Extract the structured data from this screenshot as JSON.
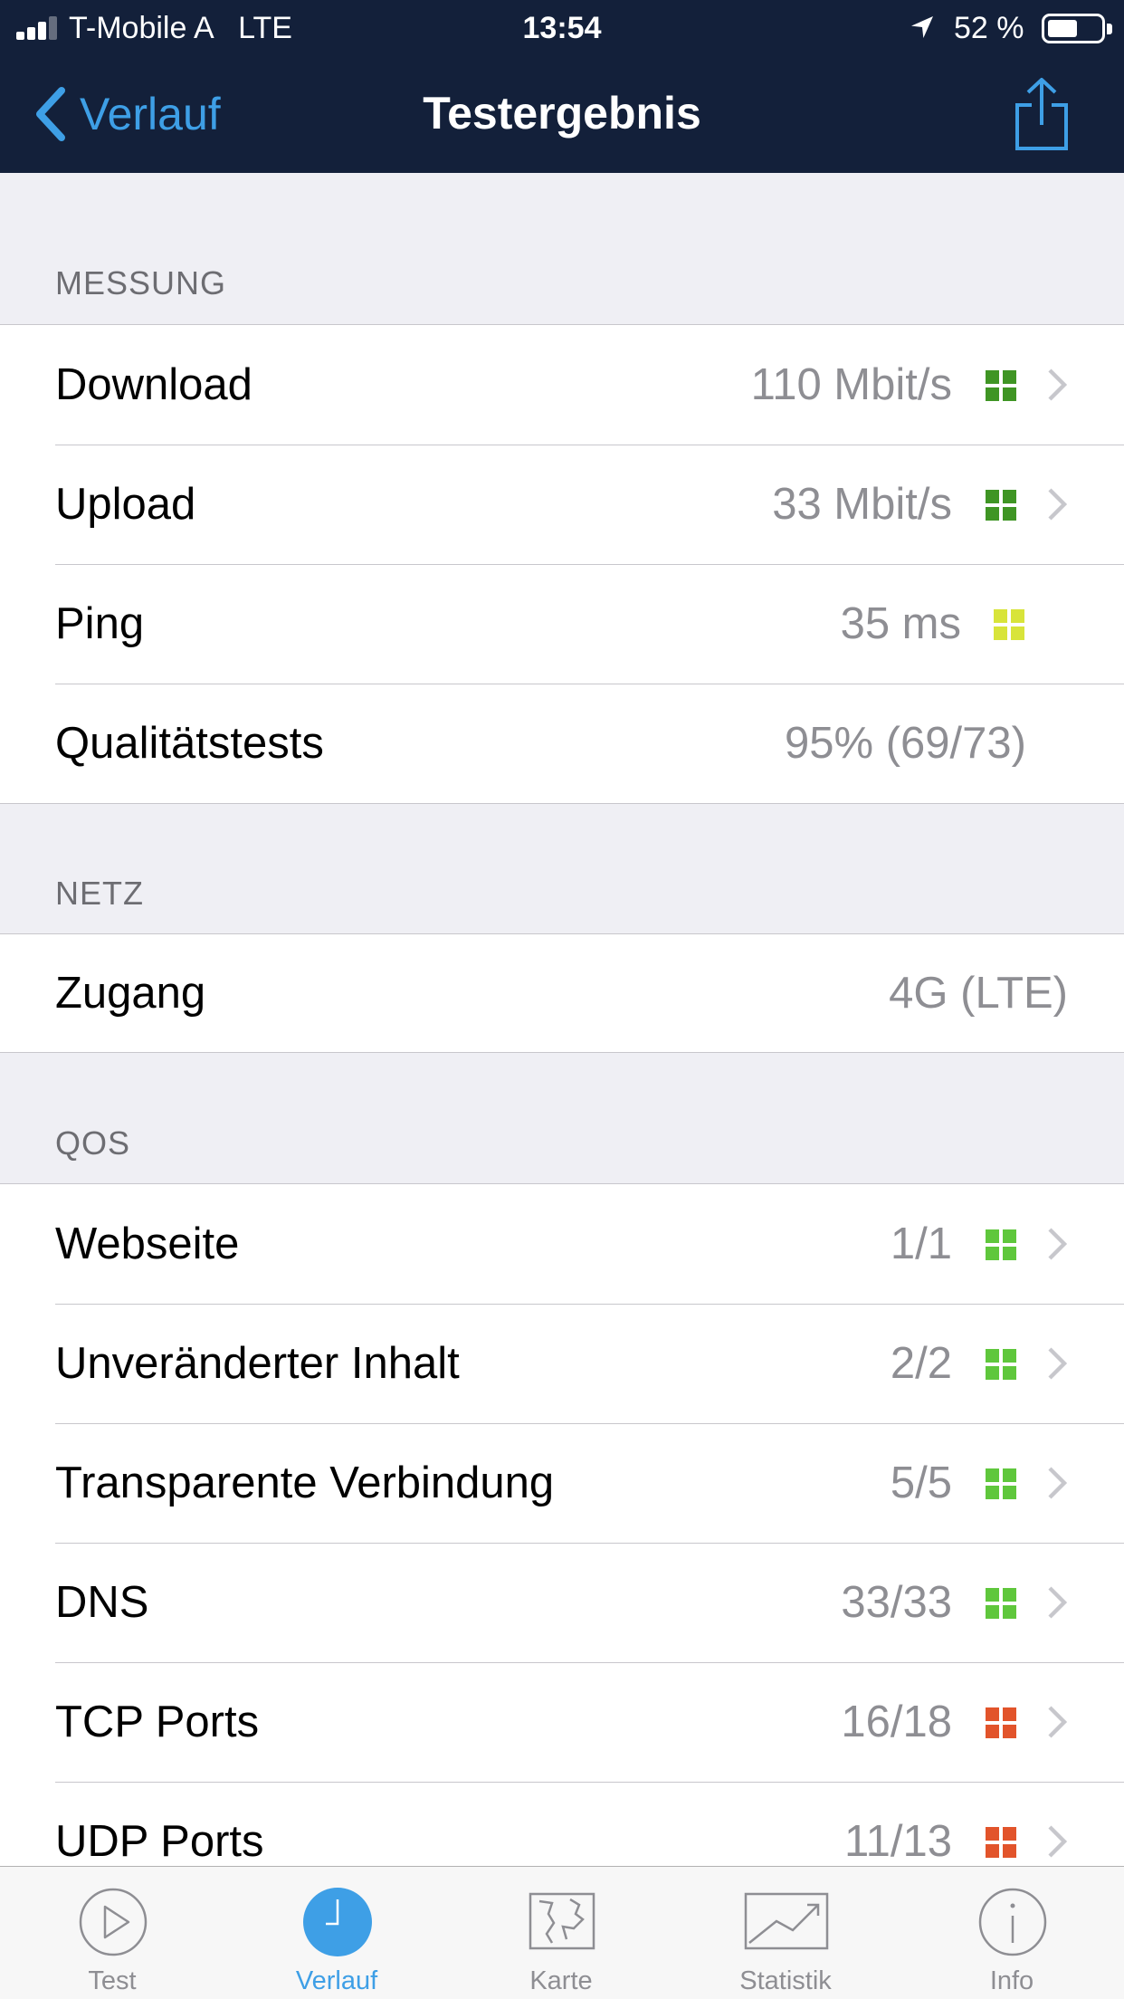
{
  "status_bar": {
    "carrier": "T-Mobile A   LTE",
    "time": "13:54",
    "battery": "52 %"
  },
  "nav": {
    "back_label": "Verlauf",
    "title": "Testergebnis"
  },
  "sections": {
    "messung": {
      "header": "MESSUNG",
      "rows": [
        {
          "label": "Download",
          "value": "110 Mbit/s",
          "status": "green",
          "chevron": true
        },
        {
          "label": "Upload",
          "value": "33 Mbit/s",
          "status": "green",
          "chevron": true
        },
        {
          "label": "Ping",
          "value": "35 ms",
          "status": "yellow",
          "chevron": false
        },
        {
          "label": "Qualitätstests",
          "value": "95% (69/73)",
          "status": "none",
          "chevron": false
        }
      ]
    },
    "netz": {
      "header": "NETZ",
      "rows": [
        {
          "label": "Zugang",
          "value": "4G (LTE)"
        }
      ]
    },
    "qos": {
      "header": "QOS",
      "rows": [
        {
          "label": "Webseite",
          "value": "1/1",
          "status": "light-green",
          "chevron": true
        },
        {
          "label": "Unveränderter Inhalt",
          "value": "2/2",
          "status": "light-green",
          "chevron": true
        },
        {
          "label": "Transparente Verbindung",
          "value": "5/5",
          "status": "light-green",
          "chevron": true
        },
        {
          "label": "DNS",
          "value": "33/33",
          "status": "light-green",
          "chevron": true
        },
        {
          "label": "TCP Ports",
          "value": "16/18",
          "status": "orange",
          "chevron": true
        },
        {
          "label": "UDP Ports",
          "value": "11/13",
          "status": "orange",
          "chevron": true
        }
      ]
    }
  },
  "status_colors": {
    "green": "#3f9524",
    "yellow": "#d8e43a",
    "light-green": "#5fc73c",
    "orange": "#e2542b"
  },
  "tabbar": {
    "active": "Verlauf",
    "tabs": [
      {
        "label": "Test",
        "icon": "play-circle-icon"
      },
      {
        "label": "Verlauf",
        "icon": "clock-icon"
      },
      {
        "label": "Karte",
        "icon": "map-icon"
      },
      {
        "label": "Statistik",
        "icon": "chart-icon"
      },
      {
        "label": "Info",
        "icon": "info-icon"
      }
    ]
  },
  "colors": {
    "nav_background": "#13203a",
    "accent": "#3e9fe6",
    "list_background": "#efeff4"
  }
}
